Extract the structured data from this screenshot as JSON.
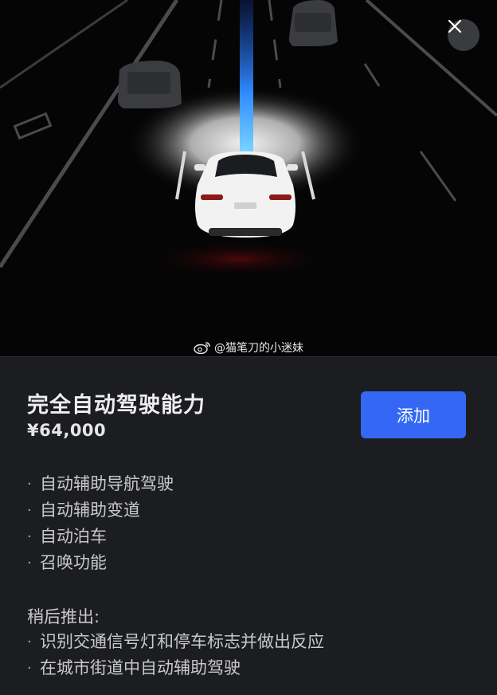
{
  "watermark": "@猫笔刀的小迷妹",
  "product": {
    "title": "完全自动驾驶能力",
    "price": "¥64,000",
    "add_label": "添加"
  },
  "features": [
    "自动辅助导航驾驶",
    "自动辅助变道",
    "自动泊车",
    "召唤功能"
  ],
  "later": {
    "label": "稍后推出:",
    "items": [
      "识别交通信号灯和停车标志并做出反应",
      "在城市街道中自动辅助驾驶"
    ]
  },
  "bullet": "·",
  "colors": {
    "accent": "#3468f4",
    "path": "#2f8cff",
    "panel": "#1c1d20"
  }
}
